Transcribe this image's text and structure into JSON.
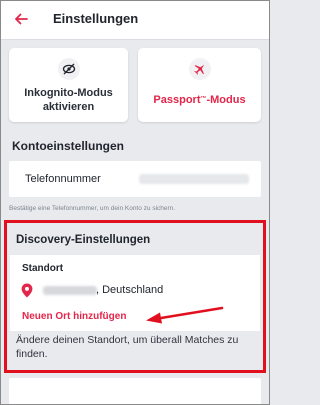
{
  "header": {
    "title": "Einstellungen",
    "back_icon": "arrow-left-icon",
    "accent": "#e3264a"
  },
  "cards": {
    "incognito": {
      "label": "Inkognito-Modus aktivieren",
      "icon": "mask-icon"
    },
    "passport": {
      "label": "Passport",
      "trademark": "™",
      "label_suffix": "-Modus",
      "icon": "plane-icon"
    }
  },
  "account": {
    "heading": "Kontoeinstellungen",
    "phone_label": "Telefonnummer",
    "hint": "Bestätige eine Telefonnummer, um dein Konto zu sichern."
  },
  "discovery": {
    "heading": "Discovery-Einstellungen",
    "location_label": "Standort",
    "location_country": ", Deutschland",
    "add_location": "Neuen Ort hinzufügen",
    "description": "Ändere deinen Standort, um überall Matches zu finden.",
    "highlight_color": "#e0101f"
  }
}
